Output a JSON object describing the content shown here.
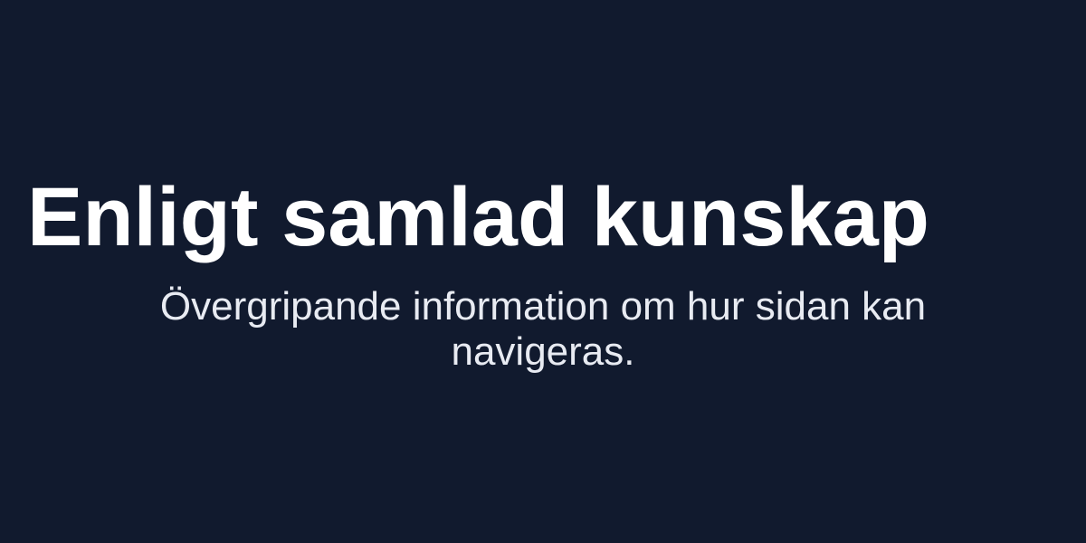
{
  "heading": {
    "title": "Enligt samlad kunskap",
    "subtitle": "Övergripande information om hur sidan kan navigeras."
  },
  "colors": {
    "background": "#111a2e",
    "title": "#ffffff",
    "subtitle": "#e8ebf2"
  }
}
